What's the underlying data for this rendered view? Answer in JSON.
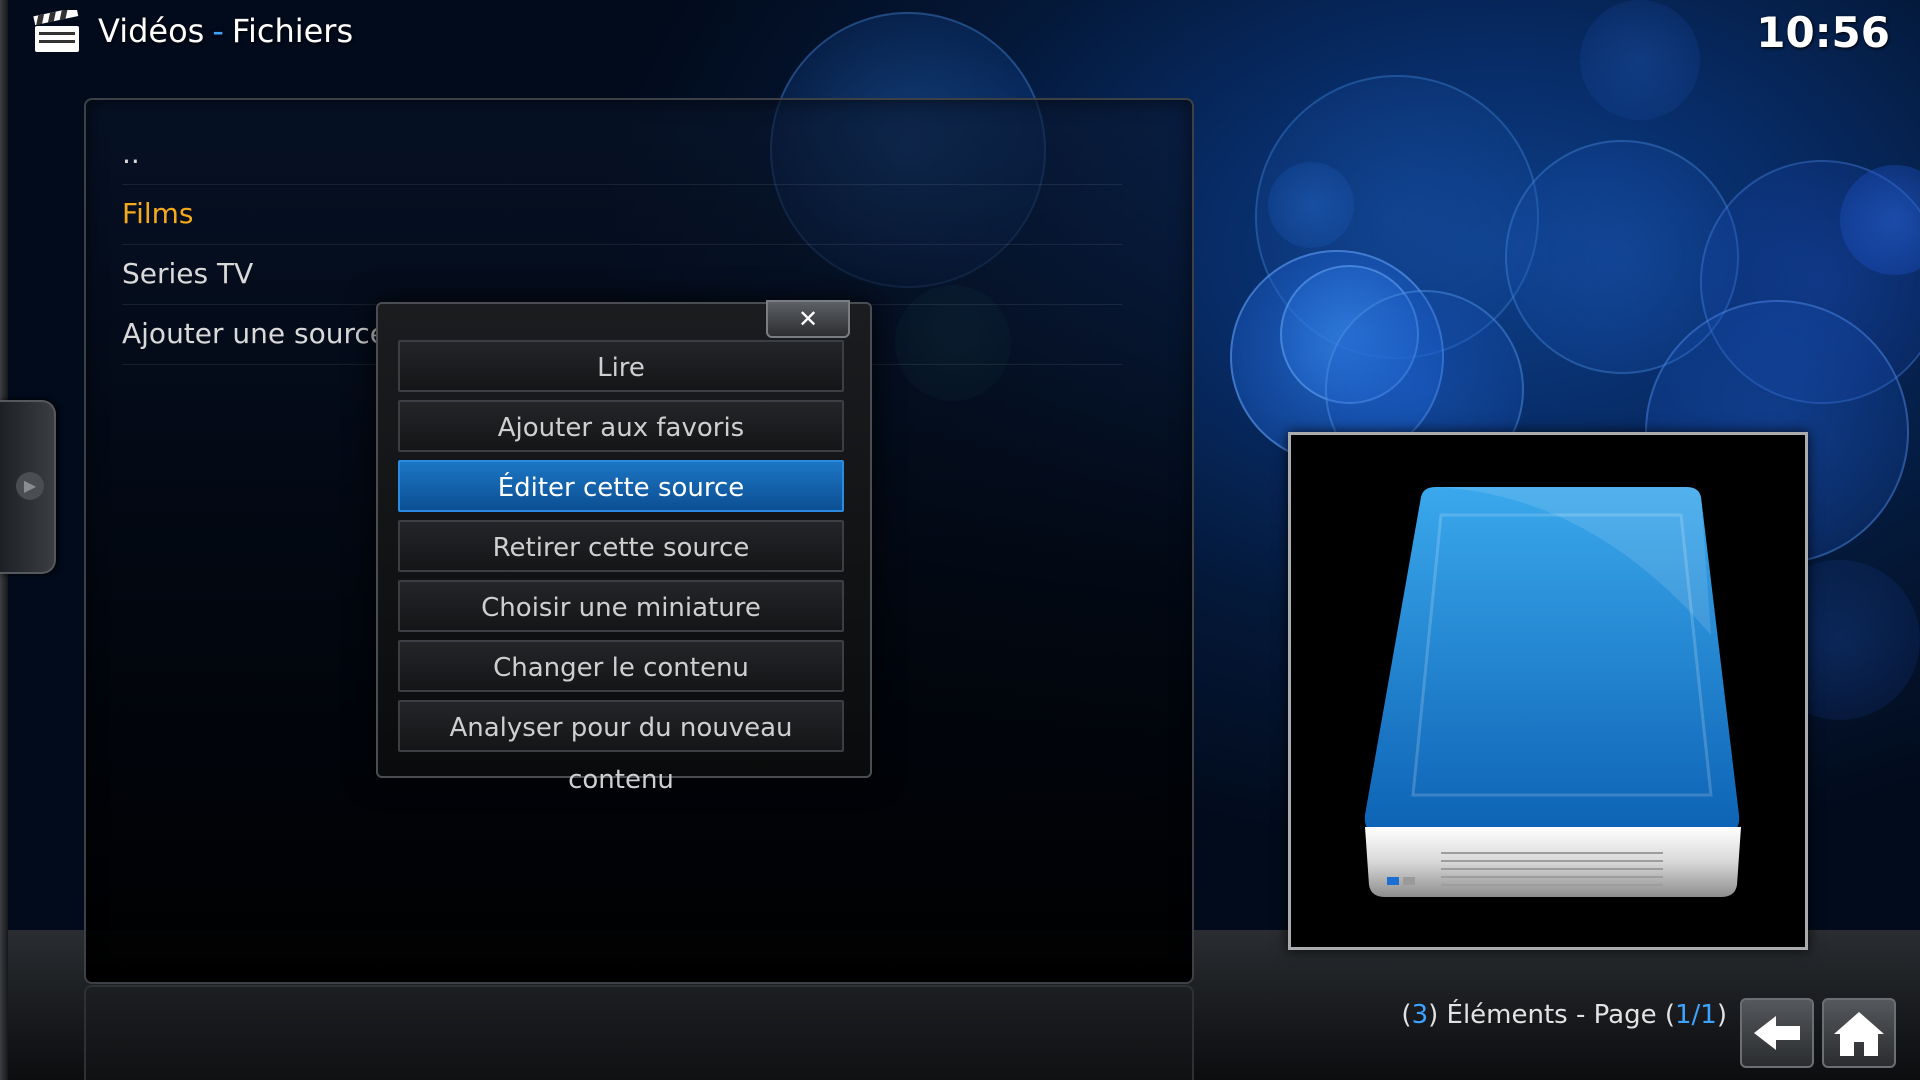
{
  "header": {
    "section": "Vidéos",
    "separator": "-",
    "subsection": "Fichiers",
    "icon": "clapperboard-icon"
  },
  "clock": "10:56",
  "file_list": {
    "items": [
      {
        "label": "..",
        "active": false
      },
      {
        "label": "Films",
        "active": true
      },
      {
        "label": "Series TV",
        "active": false
      },
      {
        "label": "Ajouter une source",
        "active": false
      }
    ],
    "accent_color": "#f7a91c"
  },
  "context_menu": {
    "close_icon": "close-icon",
    "items": [
      {
        "label": "Lire"
      },
      {
        "label": "Ajouter aux favoris"
      },
      {
        "label": "Éditer cette source",
        "focused": true
      },
      {
        "label": "Retirer cette source"
      },
      {
        "label": "Choisir une miniature"
      },
      {
        "label": "Changer le contenu"
      },
      {
        "label": "Analyser pour du nouveau contenu"
      }
    ],
    "focus_color": "#1c76c4"
  },
  "thumbnail": {
    "icon": "hard-drive-icon"
  },
  "footer": {
    "count": "3",
    "elements_label": "Éléments - Page",
    "page": "1/1",
    "back_icon": "back-arrow-icon",
    "home_icon": "home-icon"
  }
}
